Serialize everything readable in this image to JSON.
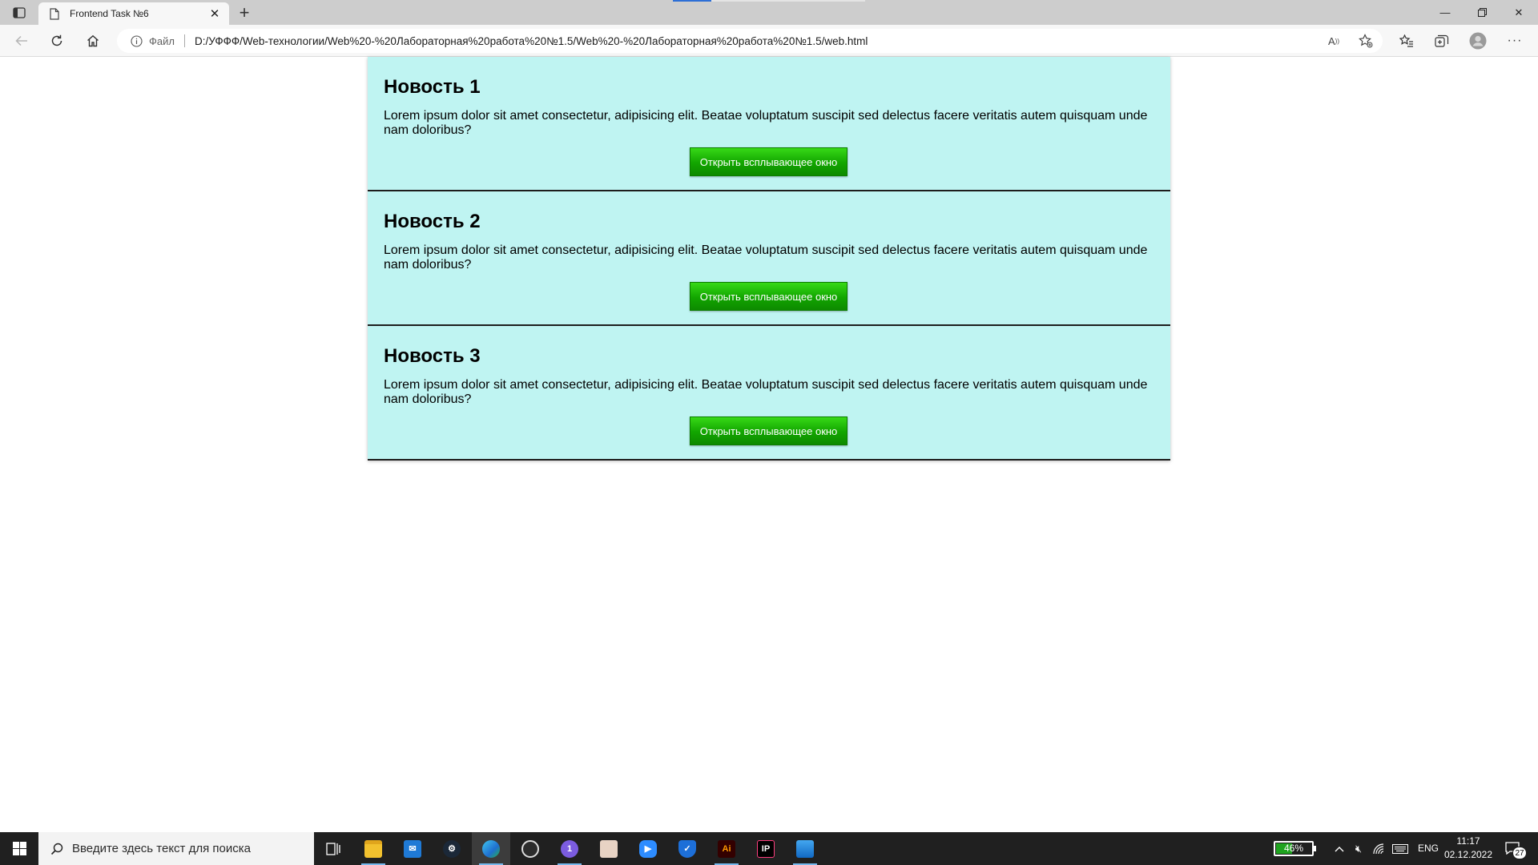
{
  "browser": {
    "tab_title": "Frontend Task №6",
    "scheme_label": "Файл",
    "url": "D:/УФФФ/Web-технологии/Web%20-%20Лабораторная%20работа%20№1.5/Web%20-%20Лабораторная%20работа%20№1.5/web.html"
  },
  "news": [
    {
      "title": "Новость 1",
      "text": "Lorem ipsum dolor sit amet consectetur, adipisicing elit. Beatae voluptatum suscipit sed delectus facere veritatis autem quisquam unde nam doloribus?",
      "button_label": "Открыть всплывающее окно"
    },
    {
      "title": "Новость 2",
      "text": "Lorem ipsum dolor sit amet consectetur, adipisicing elit. Beatae voluptatum suscipit sed delectus facere veritatis autem quisquam unde nam doloribus?",
      "button_label": "Открыть всплывающее окно"
    },
    {
      "title": "Новость 3",
      "text": "Lorem ipsum dolor sit amet consectetur, adipisicing elit. Beatae voluptatum suscipit sed delectus facere veritatis autem quisquam unde nam doloribus?",
      "button_label": "Открыть всплывающее окно"
    }
  ],
  "colors": {
    "news_background": "#bff4f2",
    "button_green": "#12a500",
    "divider": "#1d1d1d"
  },
  "taskbar": {
    "search_placeholder": "Введите здесь текст для поиска",
    "apps": [
      "task-view-icon",
      "file-explorer-icon",
      "mail-icon",
      "steam-icon",
      "edge-icon",
      "obs-icon",
      "discord-icon",
      "game-icon",
      "zoom-icon",
      "security-icon",
      "illustrator-icon",
      "intellij-icon",
      "photos-icon"
    ],
    "battery_percent": 46,
    "battery_label": "46%",
    "language": "ENG",
    "time": "11:17",
    "date": "02.12.2022",
    "notification_count": "27"
  }
}
